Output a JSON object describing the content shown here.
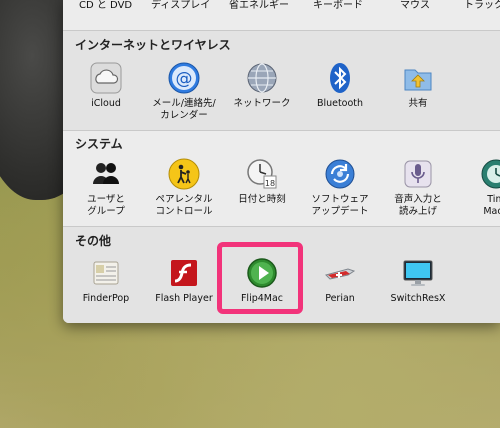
{
  "top_row": [
    "CD と DVD",
    "ディスプレイ",
    "省エネルギー",
    "キーボード",
    "マウス",
    "トラック"
  ],
  "sections": [
    {
      "title": "インターネットとワイヤレス",
      "items": [
        {
          "label": "iCloud",
          "icon": "icloud-icon"
        },
        {
          "label": "メール/連絡先/\nカレンダー",
          "icon": "mail-contacts-calendar-icon"
        },
        {
          "label": "ネットワーク",
          "icon": "network-globe-icon"
        },
        {
          "label": "Bluetooth",
          "icon": "bluetooth-icon"
        },
        {
          "label": "共有",
          "icon": "sharing-folder-icon"
        }
      ]
    },
    {
      "title": "システム",
      "items": [
        {
          "label": "ユーザと\nグループ",
          "icon": "users-groups-icon"
        },
        {
          "label": "ペアレンタル\nコントロール",
          "icon": "parental-controls-icon"
        },
        {
          "label": "日付と時刻",
          "icon": "date-time-icon"
        },
        {
          "label": "ソフトウェア\nアップデート",
          "icon": "software-update-icon"
        },
        {
          "label": "音声入力と\n読み上げ",
          "icon": "dictation-speech-icon"
        },
        {
          "label": "Tim\nMach",
          "icon": "time-machine-icon"
        }
      ]
    },
    {
      "title": "その他",
      "items": [
        {
          "label": "FinderPop",
          "icon": "finderpop-icon"
        },
        {
          "label": "Flash Player",
          "icon": "flash-player-icon"
        },
        {
          "label": "Flip4Mac",
          "icon": "flip4mac-play-icon"
        },
        {
          "label": "Perian",
          "icon": "perian-knife-icon"
        },
        {
          "label": "SwitchResX",
          "icon": "switchresx-monitor-icon"
        }
      ]
    }
  ],
  "highlight_color": "#f2337a"
}
